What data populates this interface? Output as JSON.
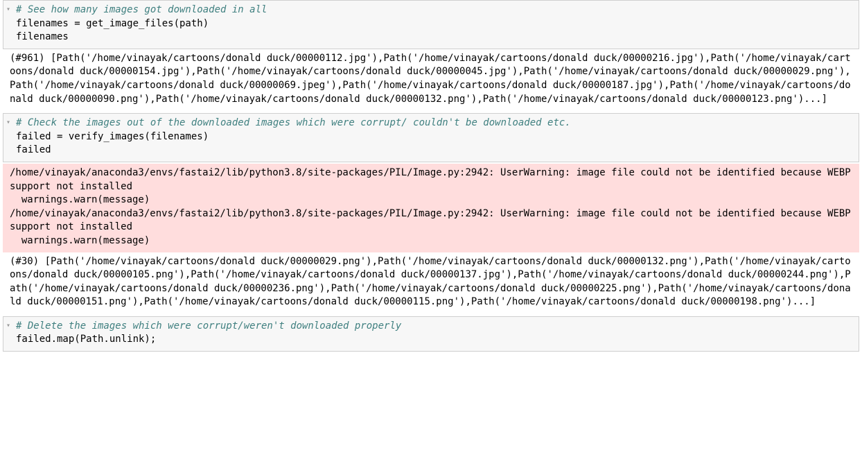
{
  "cells": [
    {
      "collapse": "▾",
      "comment": "# See how many images got downloaded in all",
      "code_lines": [
        "filenames = get_image_files(path)",
        "filenames"
      ],
      "output": "(#961) [Path('/home/vinayak/cartoons/donald duck/00000112.jpg'),Path('/home/vinayak/cartoons/donald duck/00000216.jpg'),Path('/home/vinayak/cartoons/donald duck/00000154.jpg'),Path('/home/vinayak/cartoons/donald duck/00000045.jpg'),Path('/home/vinayak/cartoons/donald duck/00000029.png'),Path('/home/vinayak/cartoons/donald duck/00000069.jpeg'),Path('/home/vinayak/cartoons/donald duck/00000187.jpg'),Path('/home/vinayak/cartoons/donald duck/00000090.png'),Path('/home/vinayak/cartoons/donald duck/00000132.png'),Path('/home/vinayak/cartoons/donald duck/00000123.png')...]"
    },
    {
      "collapse": "▾",
      "comment": "# Check the images out of the downloaded images which were corrupt/ couldn't be downloaded etc.",
      "code_lines": [
        "failed = verify_images(filenames)",
        "failed"
      ],
      "warning": "/home/vinayak/anaconda3/envs/fastai2/lib/python3.8/site-packages/PIL/Image.py:2942: UserWarning: image file could not be identified because WEBP support not installed\n  warnings.warn(message)\n/home/vinayak/anaconda3/envs/fastai2/lib/python3.8/site-packages/PIL/Image.py:2942: UserWarning: image file could not be identified because WEBP support not installed\n  warnings.warn(message)",
      "output": "(#30) [Path('/home/vinayak/cartoons/donald duck/00000029.png'),Path('/home/vinayak/cartoons/donald duck/00000132.png'),Path('/home/vinayak/cartoons/donald duck/00000105.png'),Path('/home/vinayak/cartoons/donald duck/00000137.jpg'),Path('/home/vinayak/cartoons/donald duck/00000244.png'),Path('/home/vinayak/cartoons/donald duck/00000236.png'),Path('/home/vinayak/cartoons/donald duck/00000225.png'),Path('/home/vinayak/cartoons/donald duck/00000151.png'),Path('/home/vinayak/cartoons/donald duck/00000115.png'),Path('/home/vinayak/cartoons/donald duck/00000198.png')...]"
    },
    {
      "collapse": "▾",
      "comment": "# Delete the images which were corrupt/weren't downloaded properly",
      "code_lines": [
        "failed.map(Path.unlink);"
      ]
    }
  ]
}
